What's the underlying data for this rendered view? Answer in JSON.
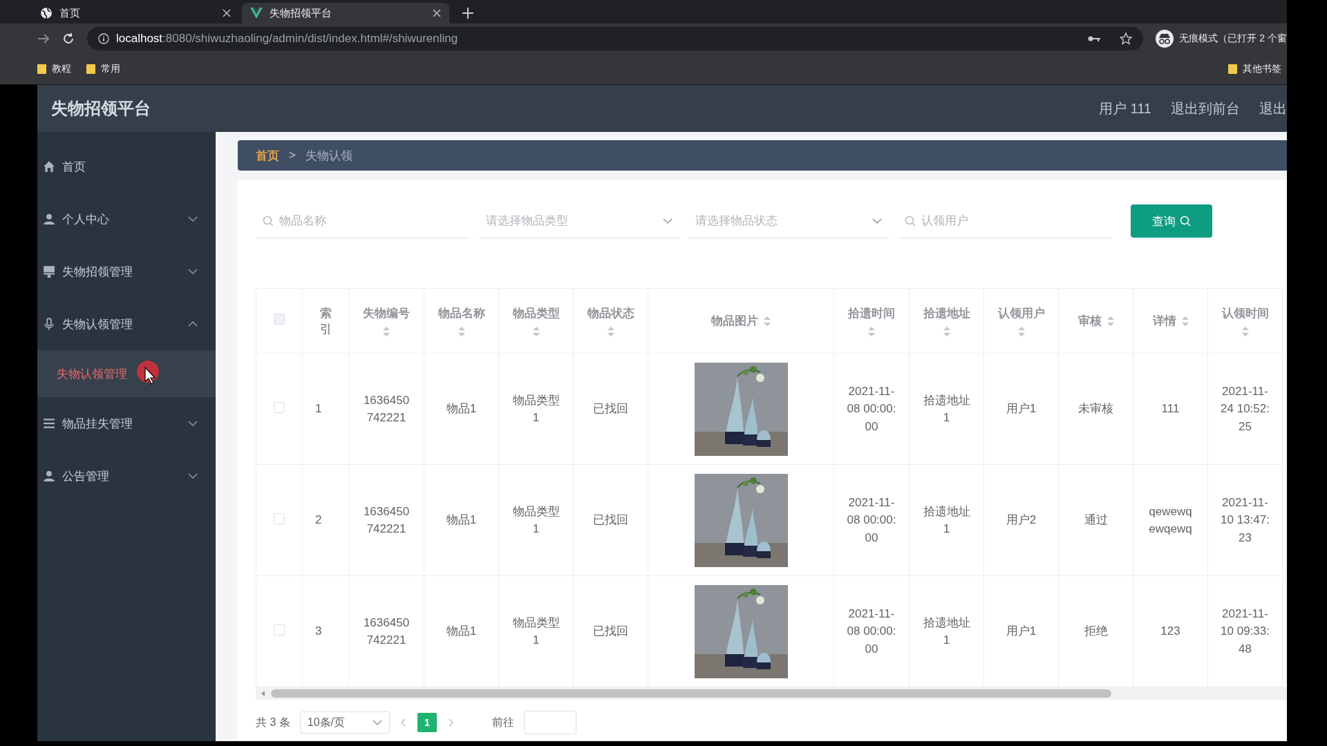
{
  "browser": {
    "tabs": [
      {
        "title": "首页",
        "selected": false
      },
      {
        "title": "失物招领平台",
        "selected": true
      }
    ],
    "url_host": "localhost",
    "url_rest": ":8080/shiwuzhaoling/admin/dist/index.html#/shiwurenling",
    "profile": "无痕模式（已打开 2 个窗",
    "bookmarks": [
      "教程",
      "常用"
    ],
    "other_bookmarks": "其他书签"
  },
  "app": {
    "title": "失物招领平台",
    "header_links": [
      "用户 111",
      "退出到前台",
      "退出"
    ]
  },
  "sidebar": {
    "items": [
      {
        "kind": "home",
        "label": "首页"
      },
      {
        "kind": "user",
        "label": "个人中心",
        "expanded": false
      },
      {
        "kind": "flag",
        "label": "失物招领管理",
        "expanded": false
      },
      {
        "kind": "mic",
        "label": "失物认领管理",
        "expanded": true,
        "children": [
          {
            "label": "失物认领管理",
            "selected": true
          }
        ]
      },
      {
        "kind": "list",
        "label": "物品挂失管理",
        "expanded": false
      },
      {
        "kind": "user",
        "label": "公告管理",
        "expanded": false
      }
    ]
  },
  "breadcrumb": [
    "首页",
    "失物认领"
  ],
  "breadcrumb_separator": ">",
  "filters": [
    {
      "kind": "search",
      "placeholder": "物品名称"
    },
    {
      "kind": "select",
      "placeholder": "请选择物品类型"
    },
    {
      "kind": "select",
      "placeholder": "请选择物品状态"
    },
    {
      "kind": "search",
      "placeholder": "认领用户"
    }
  ],
  "query_button": "查询",
  "table": {
    "all_checked": false,
    "columns": [
      {
        "label": "索引",
        "sortable": false
      },
      {
        "label": "失物编号",
        "sortable": true
      },
      {
        "label": "物品名称",
        "sortable": true
      },
      {
        "label": "物品类型",
        "sortable": true
      },
      {
        "label": "物品状态",
        "sortable": true
      },
      {
        "label": "物品图片",
        "sortable": true
      },
      {
        "label": "拾遗时间",
        "sortable": true
      },
      {
        "label": "拾遗地址",
        "sortable": true
      },
      {
        "label": "认领用户",
        "sortable": true
      },
      {
        "label": "审核",
        "sortable": true
      },
      {
        "label": "详情",
        "sortable": true
      },
      {
        "label": "认领时间",
        "sortable": true
      }
    ],
    "rows": [
      {
        "checked": false,
        "cells": [
          "1",
          "1636450742221",
          "物品1",
          "物品类型1",
          "已找回",
          {
            "kind": "picture"
          },
          "2021-11-08 00:00:00",
          "拾遗地址1",
          "用户1",
          "未审核",
          "111",
          "2021-11-24 10:52:25"
        ]
      },
      {
        "checked": false,
        "cells": [
          "2",
          "1636450742221",
          "物品1",
          "物品类型1",
          "已找回",
          {
            "kind": "picture"
          },
          "2021-11-08 00:00:00",
          "拾遗地址1",
          "用户2",
          "通过",
          "qewewqewqewq",
          "2021-11-10 13:47:23"
        ]
      },
      {
        "checked": false,
        "cells": [
          "3",
          "1636450742221",
          "物品1",
          "物品类型1",
          "已找回",
          {
            "kind": "picture"
          },
          "2021-11-08 00:00:00",
          "拾遗地址1",
          "用户1",
          "拒绝",
          "123",
          "2021-11-10 09:33:48"
        ]
      }
    ]
  },
  "pagination": {
    "total": "共 3 条",
    "page_size": "10条/页",
    "pages": [
      {
        "label": "1",
        "selected": true
      }
    ],
    "goto": "前往"
  }
}
